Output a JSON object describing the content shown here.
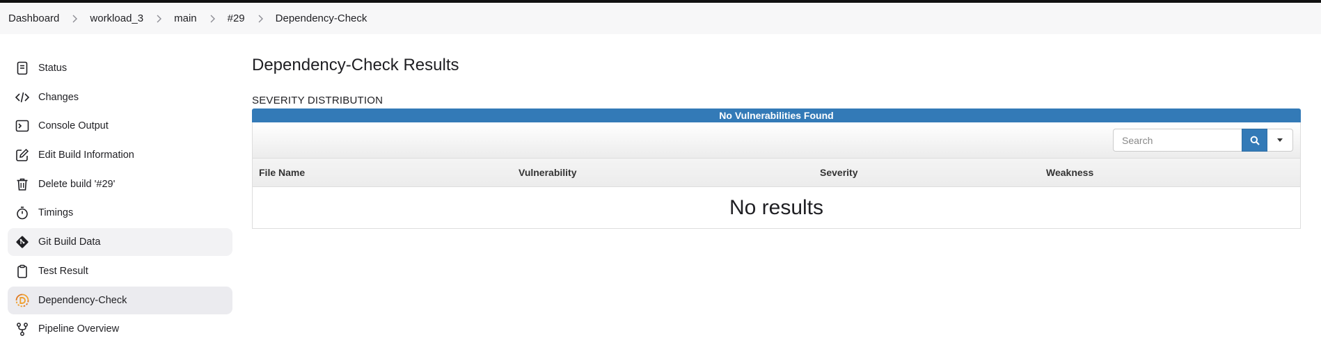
{
  "breadcrumbs": [
    "Dashboard",
    "workload_3",
    "main",
    "#29",
    "Dependency-Check"
  ],
  "sidebar": {
    "items": [
      {
        "label": "Status",
        "icon": "status-icon"
      },
      {
        "label": "Changes",
        "icon": "code-icon"
      },
      {
        "label": "Console Output",
        "icon": "terminal-icon"
      },
      {
        "label": "Edit Build Information",
        "icon": "edit-icon"
      },
      {
        "label": "Delete build '#29'",
        "icon": "trash-icon"
      },
      {
        "label": "Timings",
        "icon": "stopwatch-icon"
      },
      {
        "label": "Git Build Data",
        "icon": "git-icon"
      },
      {
        "label": "Test Result",
        "icon": "clipboard-icon"
      },
      {
        "label": "Dependency-Check",
        "icon": "dependency-check-icon"
      },
      {
        "label": "Pipeline Overview",
        "icon": "pipeline-icon"
      }
    ]
  },
  "main": {
    "title": "Dependency-Check Results",
    "severity_label": "SEVERITY DISTRIBUTION",
    "severity_bar": "No Vulnerabilities Found",
    "search": {
      "placeholder": "Search"
    },
    "columns": [
      "File Name",
      "Vulnerability",
      "Severity",
      "Weakness"
    ],
    "empty_message": "No results"
  },
  "colors": {
    "accent": "#337ab7",
    "dependency_check_icon": "#f0a030"
  }
}
